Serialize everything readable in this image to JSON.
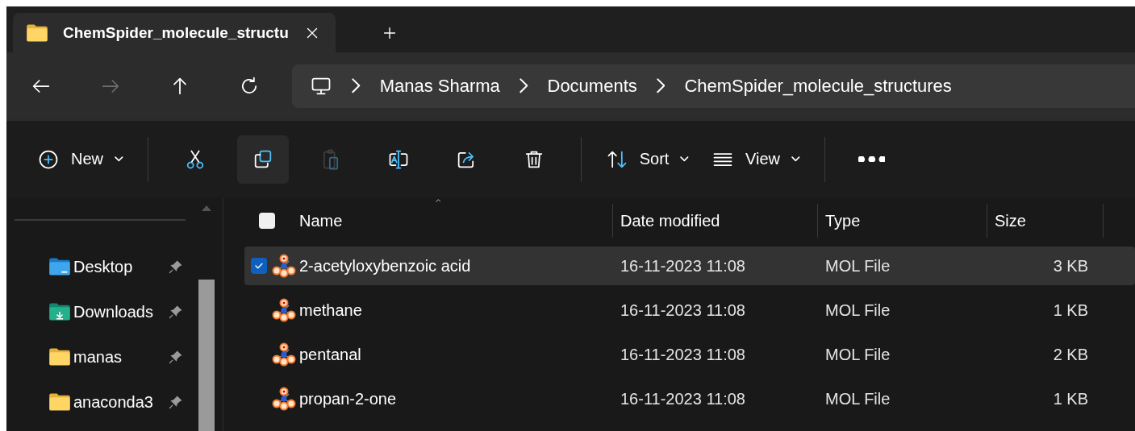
{
  "tabs": [
    {
      "label": "ChemSpider_molecule_structu",
      "selected": true
    }
  ],
  "navigation": [
    {
      "kind": "back",
      "disabled": false
    },
    {
      "kind": "forward",
      "disabled": true
    },
    {
      "kind": "up",
      "disabled": false
    },
    {
      "kind": "refresh",
      "disabled": false
    }
  ],
  "address_bar": {
    "segments": [
      "Manas Sharma",
      "Documents",
      "ChemSpider_molecule_structures"
    ]
  },
  "toolbar": {
    "items": [
      {
        "kind": "new",
        "label": "New",
        "hovered": false,
        "disabled": false
      },
      {
        "kind": "separator"
      },
      {
        "kind": "cut",
        "hovered": false,
        "disabled": false
      },
      {
        "kind": "copy",
        "hovered": true,
        "disabled": false
      },
      {
        "kind": "paste",
        "hovered": false,
        "disabled": true
      },
      {
        "kind": "rename",
        "hovered": false,
        "disabled": false
      },
      {
        "kind": "share",
        "hovered": false,
        "disabled": false
      },
      {
        "kind": "delete",
        "hovered": false,
        "disabled": false
      },
      {
        "kind": "separator"
      },
      {
        "kind": "sort",
        "label": "Sort",
        "hovered": false,
        "disabled": false
      },
      {
        "kind": "view",
        "label": "View",
        "hovered": false,
        "disabled": false
      },
      {
        "kind": "separator"
      },
      {
        "kind": "more",
        "hovered": false,
        "disabled": false
      }
    ]
  },
  "sidebar": {
    "items": [
      {
        "label": "Desktop",
        "kind": "desktop",
        "pinned": true
      },
      {
        "label": "Downloads",
        "kind": "downloads",
        "pinned": true
      },
      {
        "label": "manas",
        "kind": "folder",
        "pinned": true
      },
      {
        "label": "anaconda3",
        "kind": "folder",
        "pinned": true
      }
    ]
  },
  "file_list": {
    "select_all_checked": false,
    "columns": [
      {
        "label": "Name",
        "sorted": true
      },
      {
        "label": "Date modified",
        "sorted": false
      },
      {
        "label": "Type",
        "sorted": false
      },
      {
        "label": "Size",
        "sorted": false
      }
    ],
    "rows": [
      {
        "name": "2-acetyloxybenzoic acid",
        "date": "16-11-2023 11:08",
        "type": "MOL File",
        "size": "3 KB",
        "selected": true
      },
      {
        "name": "methane",
        "date": "16-11-2023 11:08",
        "type": "MOL File",
        "size": "1 KB",
        "selected": false
      },
      {
        "name": "pentanal",
        "date": "16-11-2023 11:08",
        "type": "MOL File",
        "size": "2 KB",
        "selected": false
      },
      {
        "name": "propan-2-one",
        "date": "16-11-2023 11:08",
        "type": "MOL File",
        "size": "1 KB",
        "selected": false
      }
    ]
  }
}
